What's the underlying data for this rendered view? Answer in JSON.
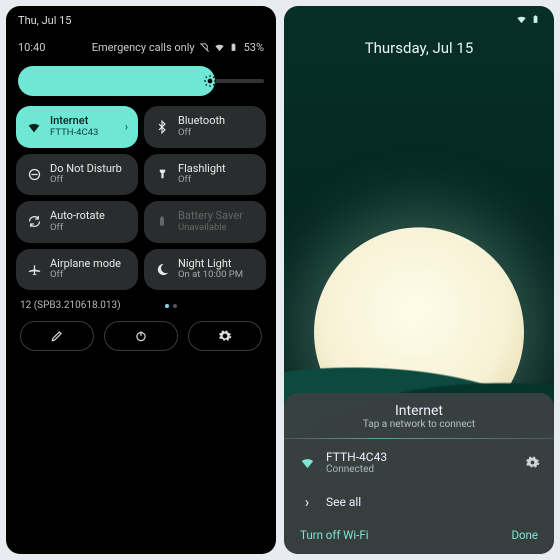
{
  "left": {
    "topbar_date": "Thu, Jul 15",
    "clock": "10:40",
    "status_text": "Emergency calls only",
    "battery_pct": "53%",
    "tiles": [
      {
        "icon": "wifi-icon",
        "label": "Internet",
        "sub": "FTTH-4C43",
        "active": true,
        "chevron": true
      },
      {
        "icon": "bluetooth-icon",
        "label": "Bluetooth",
        "sub": "Off"
      },
      {
        "icon": "dnd-icon",
        "label": "Do Not Disturb",
        "sub": "Off"
      },
      {
        "icon": "flashlight-icon",
        "label": "Flashlight",
        "sub": "Off"
      },
      {
        "icon": "auto-rotate-icon",
        "label": "Auto-rotate",
        "sub": "Off"
      },
      {
        "icon": "battery-saver-icon",
        "label": "Battery Saver",
        "sub": "Unavailable",
        "disabled": true
      },
      {
        "icon": "airplane-icon",
        "label": "Airplane mode",
        "sub": "Off"
      },
      {
        "icon": "night-light-icon",
        "label": "Night Light",
        "sub": "On at 10:00 PM"
      }
    ],
    "build": "12 (SPB3.210618.013)",
    "buttons": {
      "edit": "edit",
      "power": "power",
      "settings": "settings"
    }
  },
  "right": {
    "date": "Thursday, Jul 15",
    "sheet": {
      "title": "Internet",
      "subtitle": "Tap a network to connect",
      "network": {
        "ssid": "FTTH-4C43",
        "status": "Connected"
      },
      "see_all": "See all",
      "turn_off": "Turn off Wi-Fi",
      "done": "Done"
    }
  }
}
